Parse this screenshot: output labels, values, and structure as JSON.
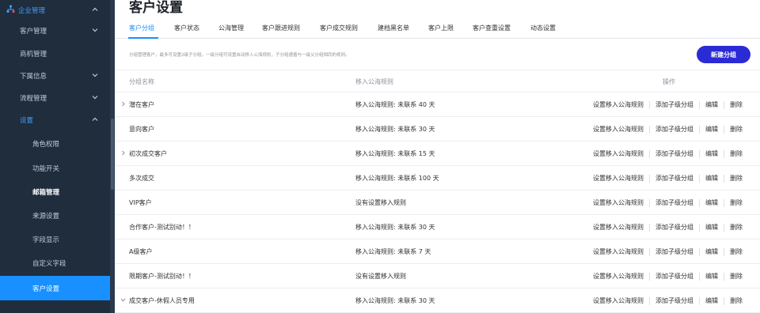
{
  "sidebar": {
    "top": {
      "label": "企业管理"
    },
    "items": [
      {
        "label": "客户管理",
        "chevron": "chevron-down"
      },
      {
        "label": "商机管理",
        "chevron": ""
      },
      {
        "label": "下属信息",
        "chevron": "chevron-down"
      },
      {
        "label": "流程管理",
        "chevron": "chevron-down"
      },
      {
        "label": "设置",
        "chevron": "chevron-up"
      }
    ],
    "sub_items": [
      {
        "label": "角色权限"
      },
      {
        "label": "功能开关"
      },
      {
        "label": "邮箱管理"
      },
      {
        "label": "来源设置"
      },
      {
        "label": "字段显示"
      },
      {
        "label": "自定义字段"
      },
      {
        "label": "客户设置"
      }
    ]
  },
  "page": {
    "title": "客户设置",
    "tabs": [
      "客户分组",
      "客户状态",
      "公海管理",
      "客户跟进规则",
      "客户成交规则",
      "建档黑名单",
      "客户上限",
      "客户查重设置",
      "动态设置"
    ],
    "hint": "分组管理客户，最多可设置2级子分组。一级分组可设置自动移入公海规则，子分组遵循与一级父分组相同的规则。",
    "new_button": "新建分组"
  },
  "table": {
    "headers": {
      "name": "分组名称",
      "rule": "移入公海规则",
      "ops": "操作"
    },
    "op_labels": {
      "set_rule": "设置移入公海规则",
      "add_sub": "添加子级分组",
      "edit": "编辑",
      "delete": "删除"
    },
    "rows": [
      {
        "name": "潜在客户",
        "rule": "移入公海规则: 未联系 40 天",
        "expandable": "right"
      },
      {
        "name": "意向客户",
        "rule": "移入公海规则: 未联系 30 天",
        "expandable": ""
      },
      {
        "name": "初次成交客户",
        "rule": "移入公海规则: 未联系 15 天",
        "expandable": "right"
      },
      {
        "name": "多次成交",
        "rule": "移入公海规则: 未联系 100 天",
        "expandable": ""
      },
      {
        "name": "VIP客户",
        "rule": "没有设置移入规则",
        "expandable": ""
      },
      {
        "name": "合作客户-测试别动！！",
        "rule": "移入公海规则: 未联系 30 天",
        "expandable": ""
      },
      {
        "name": "A级客户",
        "rule": "移入公海规则: 未联系 7 天",
        "expandable": ""
      },
      {
        "name": "限期客户-测试别动！！",
        "rule": "没有设置移入规则",
        "expandable": ""
      },
      {
        "name": "成交客户-休假人员专用",
        "rule": "移入公海规则: 未联系 30 天",
        "expandable": "down"
      }
    ]
  },
  "colors": {
    "accent": "#1890ff",
    "sidebar_bg": "#1f2d3d",
    "button": "#2b2bd6"
  }
}
